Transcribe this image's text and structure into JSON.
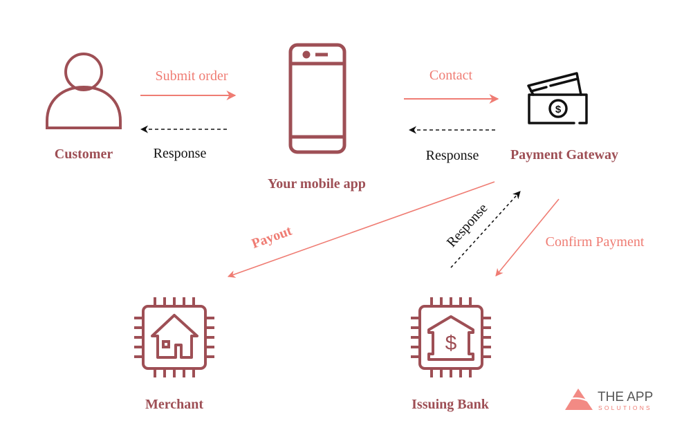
{
  "colors": {
    "node": "#9e4f55",
    "flow": "#ef7c73",
    "response": "#111111",
    "gateway_icon": "#111111"
  },
  "nodes": {
    "customer": {
      "label": "Customer",
      "icon": "person-icon"
    },
    "mobile_app": {
      "label": "Your mobile app",
      "icon": "smartphone-icon"
    },
    "payment_gateway": {
      "label": "Payment Gateway",
      "icon": "cash-cards-icon"
    },
    "merchant": {
      "label": "Merchant",
      "icon": "chip-house-icon"
    },
    "issuing_bank": {
      "label": "Issuing Bank",
      "icon": "chip-bank-icon"
    }
  },
  "edges": {
    "submit_order": {
      "label": "Submit order",
      "from": "Customer",
      "to": "Your mobile app"
    },
    "response_app_customer": {
      "label": "Response",
      "from": "Your mobile app",
      "to": "Customer"
    },
    "contact": {
      "label": "Contact",
      "from": "Your mobile app",
      "to": "Payment Gateway"
    },
    "response_gateway_app": {
      "label": "Response",
      "from": "Payment Gateway",
      "to": "Your mobile app"
    },
    "payout": {
      "label": "Payout",
      "from": "Payment Gateway",
      "to": "Merchant"
    },
    "response_bank_gateway": {
      "label": "Response",
      "from": "Issuing Bank",
      "to": "Payment Gateway"
    },
    "confirm_payment": {
      "label": "Confirm Payment",
      "from": "Payment Gateway",
      "to": "Issuing Bank"
    }
  },
  "logo": {
    "main": "THE APP",
    "sub": "SOLUTIONS"
  }
}
